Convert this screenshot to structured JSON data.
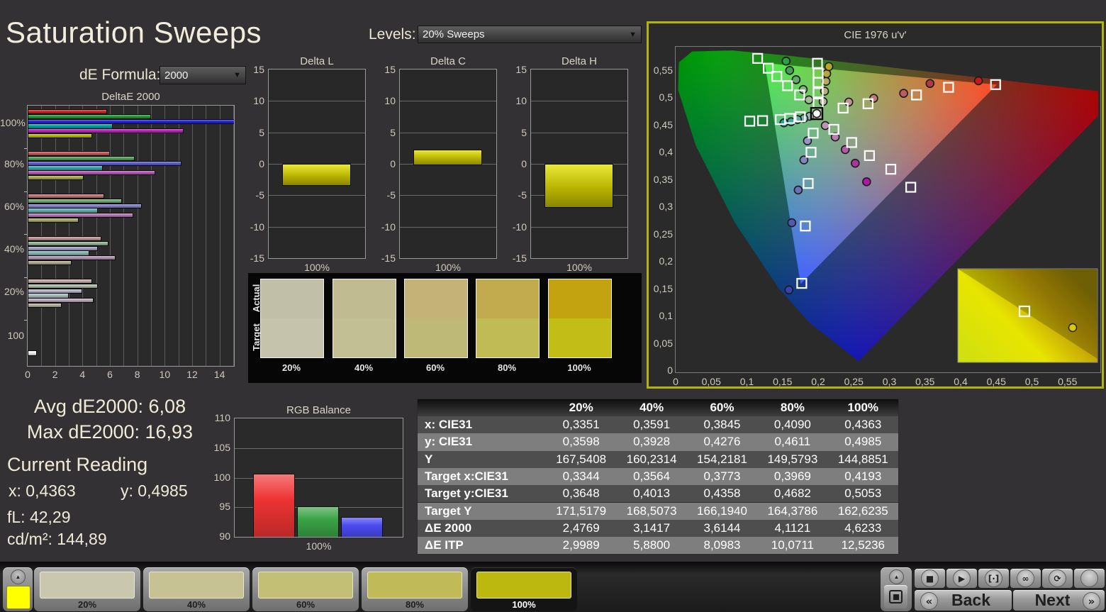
{
  "app": {
    "title": "Saturation Sweeps"
  },
  "controls": {
    "de_formula_label": "dE Formula:",
    "de_formula_value": "2000",
    "levels_label": "Levels:",
    "levels_value": "20% Sweeps"
  },
  "stats": {
    "avg": "Avg dE2000: 6,08",
    "max": "Max dE2000: 16,93",
    "current_heading": "Current Reading",
    "x": "x: 0,4363",
    "y": "y: 0,4985",
    "fl": "fL: 42,29",
    "cdm2": "cd/m²: 144,89"
  },
  "swatch_panel": {
    "row_labels": [
      "Actual",
      "Target"
    ],
    "columns": [
      {
        "label": "20%",
        "actual": "#c1bfa7",
        "target": "#c6c3ad"
      },
      {
        "label": "40%",
        "actual": "#c1bb91",
        "target": "#c2bf95"
      },
      {
        "label": "60%",
        "actual": "#c4b277",
        "target": "#beb976"
      },
      {
        "label": "80%",
        "actual": "#c2aa4e",
        "target": "#c0bb55"
      },
      {
        "label": "100%",
        "actual": "#c3a30f",
        "target": "#c2bd17"
      }
    ]
  },
  "table": {
    "headers": [
      "",
      "20%",
      "40%",
      "60%",
      "80%",
      "100%"
    ],
    "rows": [
      {
        "label": "x: CIE31",
        "values": [
          "0,3351",
          "0,3591",
          "0,3845",
          "0,4090",
          "0,4363"
        ]
      },
      {
        "label": "y: CIE31",
        "values": [
          "0,3598",
          "0,3928",
          "0,4276",
          "0,4611",
          "0,4985"
        ]
      },
      {
        "label": "Y",
        "values": [
          "167,5408",
          "160,2314",
          "154,2181",
          "149,5793",
          "144,8851"
        ]
      },
      {
        "label": "Target x:CIE31",
        "values": [
          "0,3344",
          "0,3564",
          "0,3773",
          "0,3969",
          "0,4193"
        ]
      },
      {
        "label": "Target y:CIE31",
        "values": [
          "0,3648",
          "0,4013",
          "0,4358",
          "0,4682",
          "0,5053"
        ]
      },
      {
        "label": "Target Y",
        "values": [
          "171,5179",
          "168,5073",
          "166,1940",
          "164,3786",
          "162,6235"
        ]
      },
      {
        "label": "ΔE 2000",
        "values": [
          "2,4769",
          "3,1417",
          "3,6144",
          "4,1121",
          "4,6233"
        ]
      },
      {
        "label": "ΔE ITP",
        "values": [
          "2,9989",
          "5,8800",
          "8,0983",
          "10,0711",
          "12,5236"
        ]
      }
    ]
  },
  "bottom_bar": {
    "collapse_arrow": "▲",
    "palette_swatch_color": "#ffff00",
    "tiles": [
      {
        "label": "20%",
        "color": "#c9c7ae",
        "selected": false
      },
      {
        "label": "40%",
        "color": "#c6c293",
        "selected": false
      },
      {
        "label": "60%",
        "color": "#c3bf75",
        "selected": false
      },
      {
        "label": "80%",
        "color": "#c0bb58",
        "selected": false
      },
      {
        "label": "100%",
        "color": "#bdb80f",
        "selected": true
      }
    ],
    "transport": [
      {
        "name": "stop-icon",
        "glyph": "■"
      },
      {
        "name": "play-icon",
        "glyph": "▶"
      },
      {
        "name": "single-measure-icon",
        "glyph": "[·]"
      },
      {
        "name": "continuous-icon",
        "glyph": "∞"
      },
      {
        "name": "loop-icon",
        "glyph": "⟳"
      },
      {
        "name": "blank-button",
        "glyph": ""
      }
    ],
    "back_chevron": "«",
    "back_label": "Back",
    "next_label": "Next",
    "next_chevron": "»"
  },
  "chart_data": [
    {
      "type": "bar",
      "orientation": "horizontal",
      "title": "DeltaE 2000",
      "xlim": [
        0,
        15
      ],
      "xticks": [
        0,
        2,
        4,
        6,
        8,
        10,
        12,
        14
      ],
      "series_order": [
        "red",
        "green",
        "blue",
        "cyan",
        "magenta",
        "yellow"
      ],
      "groups": [
        {
          "label": "100%",
          "values": [
            5.7,
            8.9,
            16.93,
            6.1,
            11.3,
            4.6
          ],
          "colors": [
            "#cc2222",
            "#1f9933",
            "#2222dd",
            "#00a0a0",
            "#bb22bb",
            "#b4b414"
          ]
        },
        {
          "label": "80%",
          "values": [
            5.9,
            7.7,
            11.1,
            5.4,
            9.2,
            4.0
          ],
          "colors": [
            "#c05555",
            "#4d9f55",
            "#5b5bd0",
            "#3aa3a3",
            "#b557b5",
            "#a8a84a"
          ]
        },
        {
          "label": "60%",
          "values": [
            5.5,
            6.8,
            8.2,
            5.0,
            7.6,
            3.6
          ],
          "colors": [
            "#bd7272",
            "#6fa873",
            "#7f7fc8",
            "#62aaaa",
            "#b377b3",
            "#a9a96a"
          ]
        },
        {
          "label": "40%",
          "values": [
            5.3,
            5.8,
            5.0,
            4.4,
            6.3,
            3.1
          ],
          "colors": [
            "#bd8f8f",
            "#8fb18f",
            "#9f9fc4",
            "#86b0b0",
            "#b392b3",
            "#ada98a"
          ]
        },
        {
          "label": "20%",
          "values": [
            4.6,
            5.0,
            3.9,
            2.9,
            4.7,
            2.4
          ],
          "colors": [
            "#c0a8a8",
            "#a8bba8",
            "#b3b3c6",
            "#a4b8b8",
            "#bba9bb",
            "#b3b09a"
          ]
        },
        {
          "label": "100",
          "values": [
            0.55
          ],
          "colors": [
            "#f0f0f0"
          ]
        }
      ]
    },
    {
      "type": "bar",
      "title": "Delta L",
      "categories": [
        "100%"
      ],
      "values": [
        -3.3
      ],
      "ylim": [
        -15,
        15
      ],
      "yticks": [
        15,
        10,
        5,
        0,
        -5,
        -10,
        -15
      ]
    },
    {
      "type": "bar",
      "title": "Delta C",
      "categories": [
        "100%"
      ],
      "values": [
        2.2
      ],
      "ylim": [
        -15,
        15
      ],
      "yticks": [
        15,
        10,
        5,
        0,
        -5,
        -10,
        -15
      ]
    },
    {
      "type": "bar",
      "title": "Delta H",
      "categories": [
        "100%"
      ],
      "values": [
        -6.8
      ],
      "ylim": [
        -15,
        15
      ],
      "yticks": [
        15,
        10,
        5,
        0,
        -5,
        -10,
        -15
      ]
    },
    {
      "type": "bar",
      "title": "RGB Balance",
      "categories": [
        "100%"
      ],
      "series": [
        {
          "name": "Red",
          "value": 100.6,
          "color": "#ee3333"
        },
        {
          "name": "Green",
          "value": 95.2,
          "color": "#3aa347"
        },
        {
          "name": "Blue",
          "value": 93.4,
          "color": "#4a4af0"
        }
      ],
      "ylim": [
        90,
        110
      ],
      "yticks": [
        110,
        105,
        100,
        95,
        90
      ]
    },
    {
      "type": "scatter",
      "title": "CIE 1976 u'v'",
      "xticks": [
        "0",
        "0,05",
        "0,1",
        "0,15",
        "0,2",
        "0,25",
        "0,3",
        "0,35",
        "0,4",
        "0,45",
        "0,5",
        "0,55"
      ],
      "yticks": [
        "0,55",
        "0,5",
        "0,45",
        "0,4",
        "0,35",
        "0,3",
        "0,25",
        "0,2",
        "0,15",
        "0,1",
        "0,05",
        "0"
      ],
      "white_point": {
        "target_uv": [
          0.198,
          0.47
        ],
        "measured_uv": [
          0.198,
          0.47
        ]
      },
      "sweeps": [
        {
          "name": "red",
          "targets": [
            [
              0.235,
              0.48
            ],
            [
              0.27,
              0.488
            ],
            [
              0.338,
              0.504
            ],
            [
              0.383,
              0.518
            ],
            [
              0.449,
              0.523
            ]
          ],
          "measured": [
            [
              0.243,
              0.491
            ],
            [
              0.278,
              0.498
            ],
            [
              0.32,
              0.507
            ],
            [
              0.357,
              0.525
            ],
            [
              0.425,
              0.53
            ]
          ],
          "measured_colors": [
            "#c49393",
            "#c17878",
            "#bc5a5e",
            "#b03a40",
            "#c51a1a"
          ]
        },
        {
          "name": "green",
          "targets": [
            [
              0.174,
              0.504
            ],
            [
              0.157,
              0.521
            ],
            [
              0.142,
              0.538
            ],
            [
              0.13,
              0.553
            ],
            [
              0.115,
              0.571
            ]
          ],
          "measured": [
            [
              0.187,
              0.495
            ],
            [
              0.179,
              0.514
            ],
            [
              0.169,
              0.532
            ],
            [
              0.16,
              0.549
            ],
            [
              0.155,
              0.566
            ]
          ],
          "measured_colors": [
            "#a3bd98",
            "#86b580",
            "#65ab68",
            "#42a154",
            "#2f9e44"
          ]
        },
        {
          "name": "blue",
          "targets": [
            [
              0.193,
              0.434
            ],
            [
              0.19,
              0.399
            ],
            [
              0.186,
              0.342
            ],
            [
              0.182,
              0.264
            ],
            [
              0.177,
              0.159
            ]
          ],
          "measured": [
            [
              0.185,
              0.42
            ],
            [
              0.18,
              0.385
            ],
            [
              0.172,
              0.33
            ],
            [
              0.163,
              0.27
            ],
            [
              0.159,
              0.147
            ]
          ],
          "measured_colors": [
            "#9296c4",
            "#8085c0",
            "#6a72ba",
            "#5159b2",
            "#3c41b0"
          ]
        },
        {
          "name": "cyan",
          "targets": [
            [
              0.175,
              0.464
            ],
            [
              0.16,
              0.461
            ],
            [
              0.147,
              0.459
            ],
            [
              0.122,
              0.457
            ],
            [
              0.104,
              0.456
            ]
          ],
          "measured": [
            [
              0.188,
              0.465
            ],
            [
              0.18,
              0.461
            ],
            [
              0.171,
              0.459
            ],
            [
              0.162,
              0.455
            ],
            [
              0.152,
              0.453
            ]
          ],
          "measured_colors": [
            "#9abcb4",
            "#7fb6ad",
            "#60aea4",
            "#41a79c",
            "#25a49b"
          ]
        },
        {
          "name": "magenta",
          "targets": [
            [
              0.222,
              0.441
            ],
            [
              0.247,
              0.417
            ],
            [
              0.272,
              0.393
            ],
            [
              0.302,
              0.368
            ],
            [
              0.33,
              0.335
            ]
          ],
          "measured": [
            [
              0.21,
              0.448
            ],
            [
              0.224,
              0.427
            ],
            [
              0.238,
              0.404
            ],
            [
              0.252,
              0.379
            ],
            [
              0.268,
              0.345
            ]
          ],
          "measured_colors": [
            "#bf93b8",
            "#bb7cb2",
            "#b25aa8",
            "#a8379c",
            "#ab1aa0"
          ]
        },
        {
          "name": "yellow",
          "targets": [
            [
              0.2,
              0.489
            ],
            [
              0.2,
              0.508
            ],
            [
              0.2,
              0.527
            ],
            [
              0.2,
              0.544
            ],
            [
              0.199,
              0.562
            ]
          ],
          "measured": [
            [
              0.207,
              0.492
            ],
            [
              0.209,
              0.511
            ],
            [
              0.211,
              0.529
            ],
            [
              0.212,
              0.543
            ],
            [
              0.215,
              0.556
            ]
          ],
          "measured_colors": [
            "#b8b595",
            "#b6b079",
            "#b5ac5b",
            "#b4a63d",
            "#b8a81f"
          ]
        }
      ],
      "inset": {
        "present": true,
        "marker_dot_color": "#d8ca06"
      }
    }
  ]
}
